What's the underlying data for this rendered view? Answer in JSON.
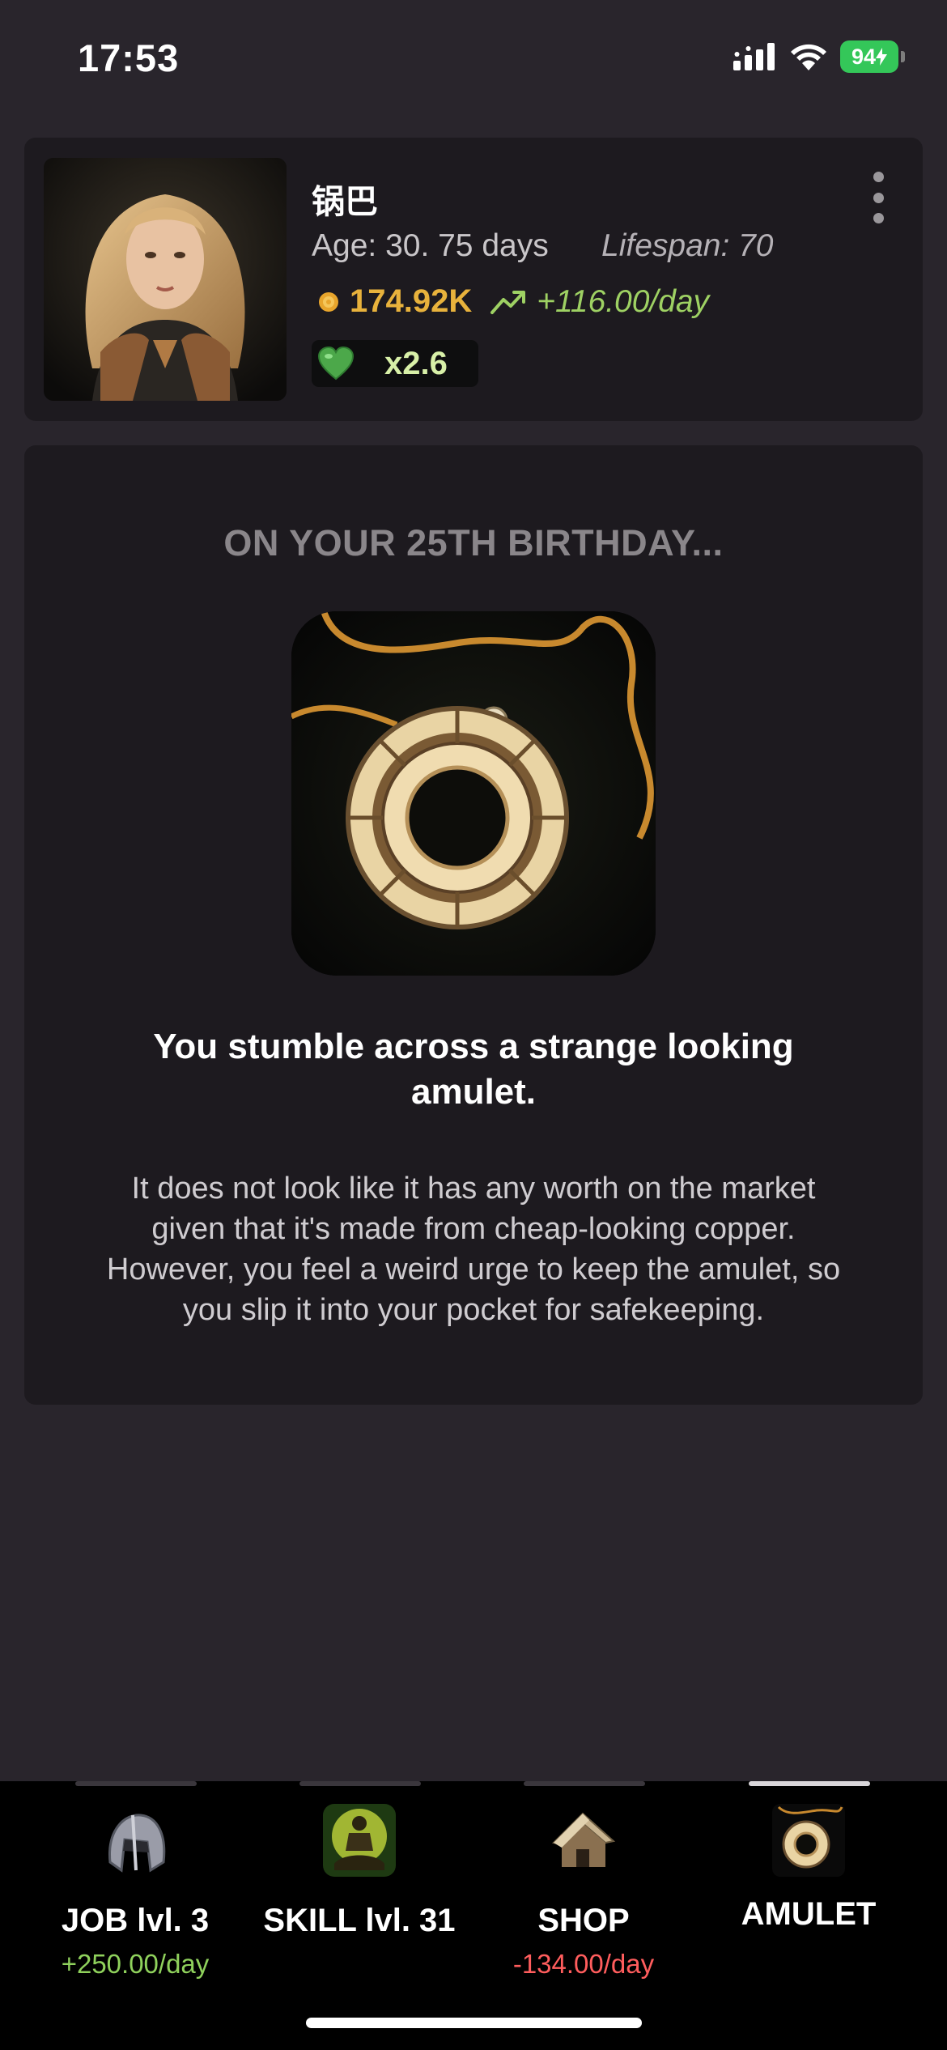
{
  "status_bar": {
    "time": "17:53",
    "battery": "94"
  },
  "character": {
    "name": "锅巴",
    "age": "Age: 30. 75 days",
    "lifespan": "Lifespan: 70",
    "coins": "174.92K",
    "income": "+116.00/day",
    "multiplier": "x2.6"
  },
  "event": {
    "title": "ON YOUR 25TH BIRTHDAY...",
    "heading": "You stumble across a strange looking amulet.",
    "body": "It does not look like it has any worth on the market given that it's made from cheap-looking copper. However, you feel a weird urge to keep the amulet, so you slip it into your pocket for safekeeping."
  },
  "nav": {
    "tabs": [
      {
        "label": "JOB lvl. 3",
        "sub": "+250.00/day",
        "icon": "helmet-icon"
      },
      {
        "label": "SKILL lvl. 31",
        "sub": "",
        "icon": "meditation-icon"
      },
      {
        "label": "SHOP",
        "sub": "-134.00/day",
        "icon": "hut-icon"
      },
      {
        "label": "AMULET",
        "sub": "",
        "icon": "amulet-icon",
        "active": true
      }
    ]
  },
  "colors": {
    "background": "#29252c",
    "card": "#1d1a1f",
    "coin": "#e8b23c",
    "positive": "#8fd15c",
    "negative": "#ff5d5d"
  }
}
